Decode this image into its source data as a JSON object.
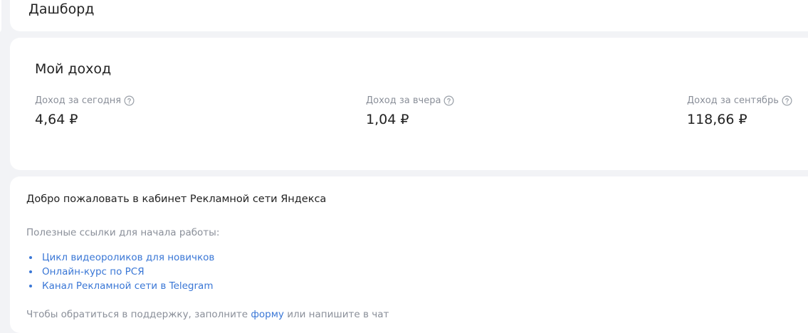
{
  "header": {
    "title": "Дашборд"
  },
  "income": {
    "title": "Мой доход",
    "metrics": [
      {
        "label": "Доход за сегодня",
        "value": "4,64 ₽"
      },
      {
        "label": "Доход за вчера",
        "value": "1,04 ₽"
      },
      {
        "label": "Доход за сентябрь",
        "value": "118,66 ₽"
      }
    ],
    "help_icon": "question-circle-icon"
  },
  "welcome": {
    "title": "Добро пожаловать в кабинет Рекламной сети Яндекса",
    "links_intro": "Полезные ссылки для начала работы:",
    "links": [
      "Цикл видеороликов для новичков",
      "Онлайн-курс по РСЯ",
      "Канал Рекламной сети в Telegram"
    ],
    "support_prefix": "Чтобы обратиться в поддержку, заполните ",
    "support_link": "форму",
    "support_suffix": " или напишите в чат"
  },
  "colors": {
    "link": "#3a77d6",
    "muted": "#8a8f99",
    "background": "#f2f3f6"
  }
}
